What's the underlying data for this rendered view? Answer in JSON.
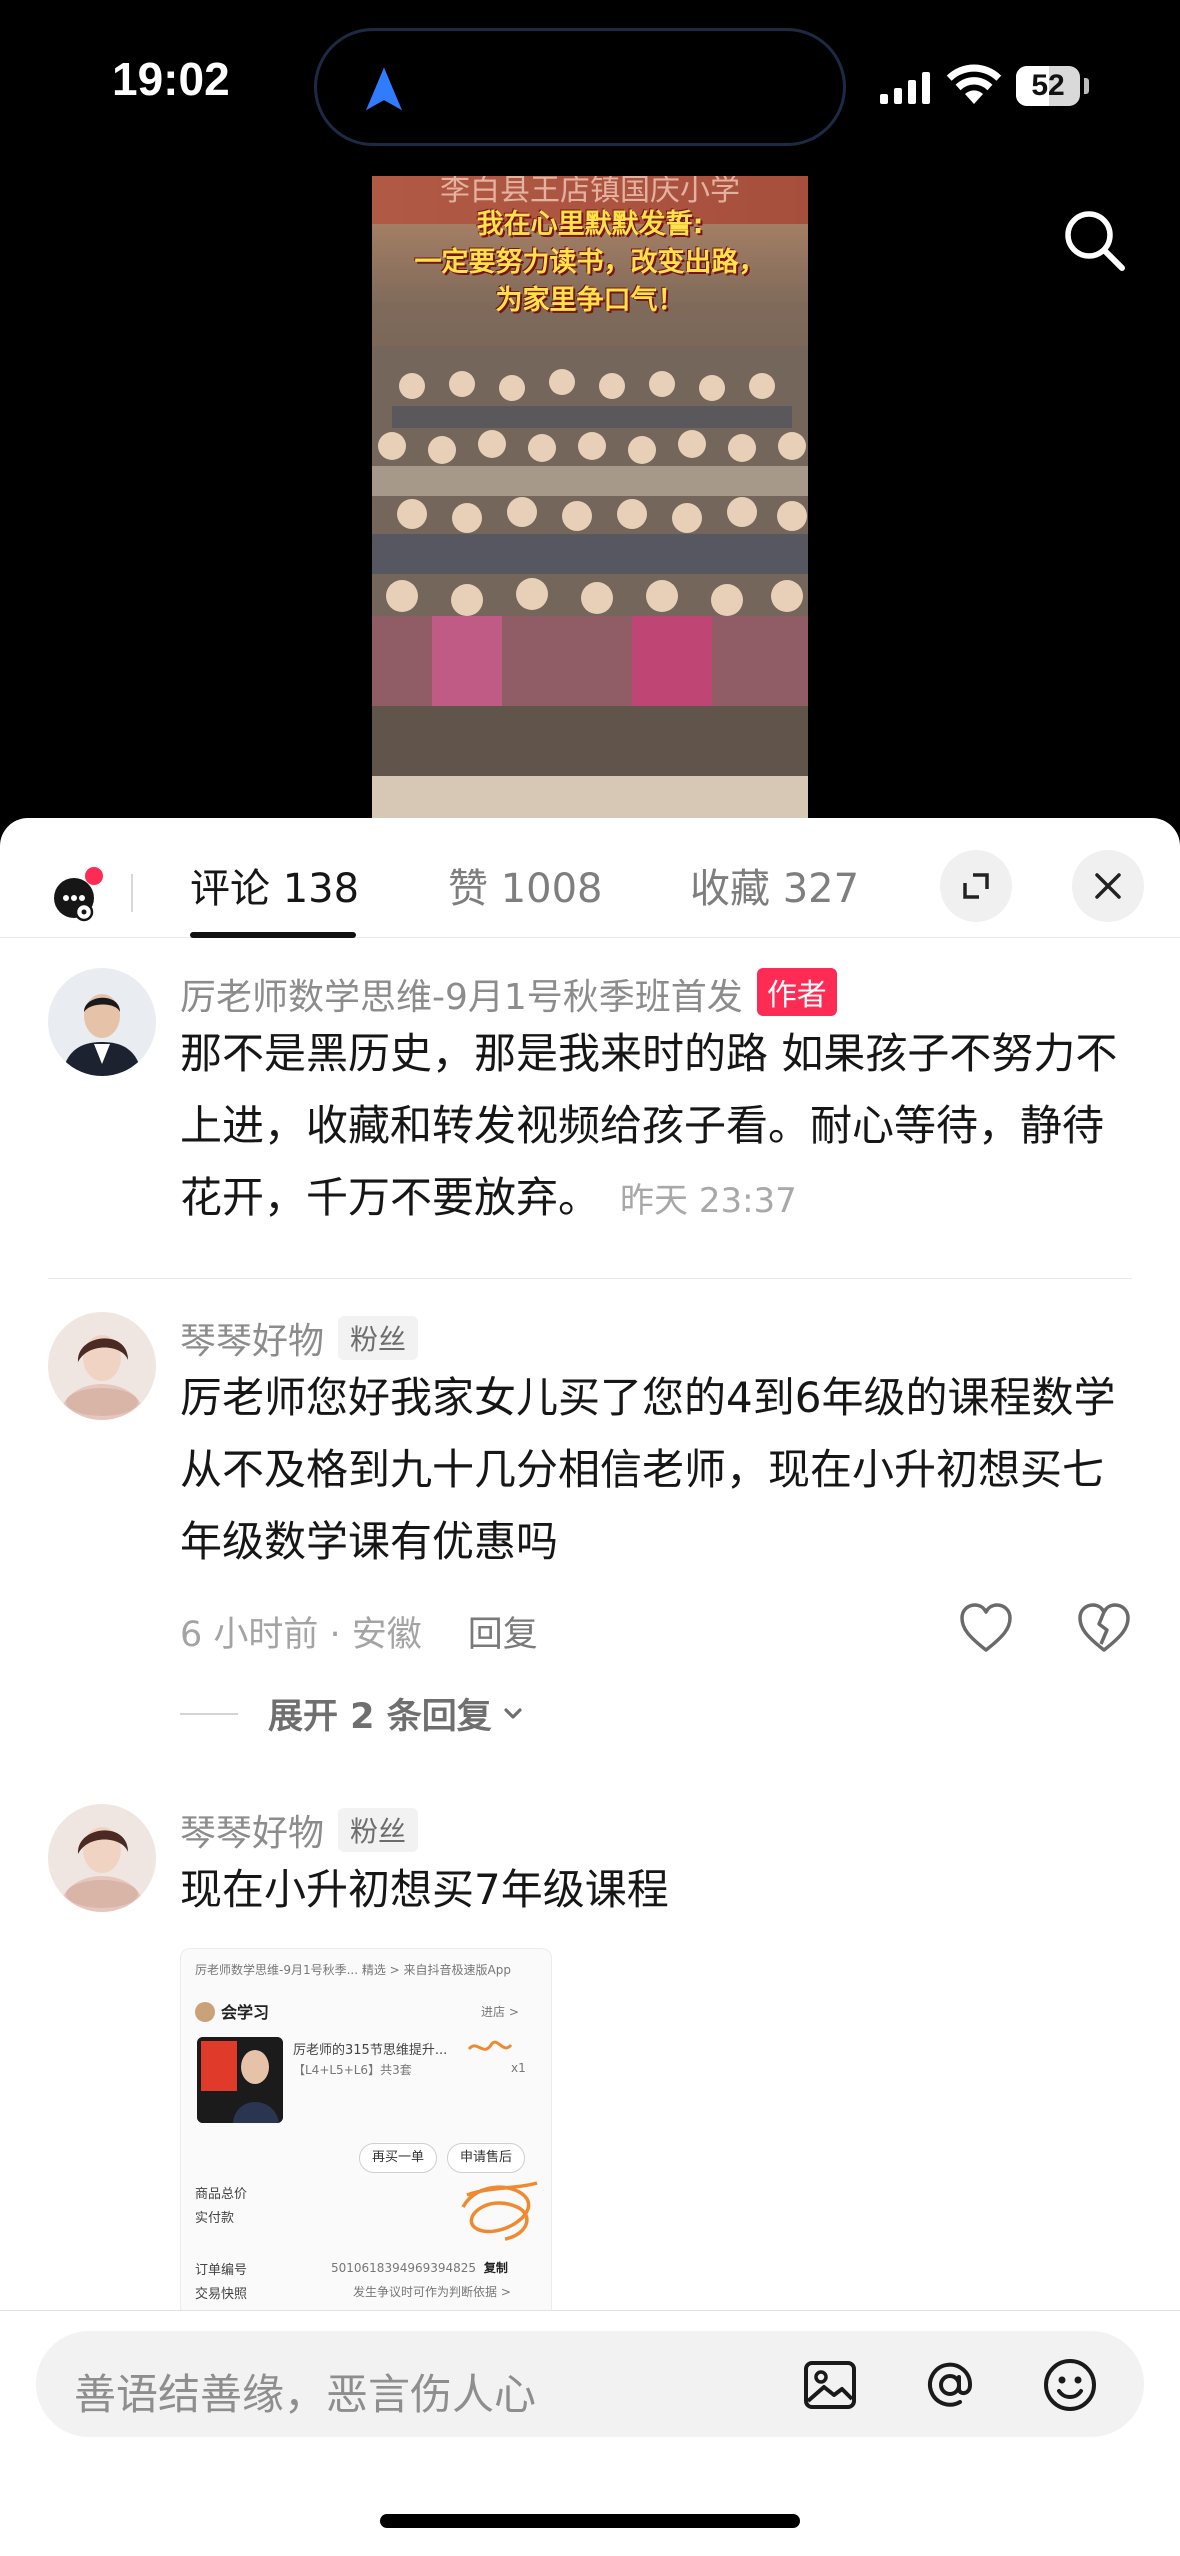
{
  "status": {
    "time": "19:02",
    "battery": "52",
    "battery_level": 0.52
  },
  "video": {
    "top_text": "李白县王店镇国庆小学",
    "caption": [
      "我在心里默默发誓:",
      "一定要努力读书，改变出路，",
      "为家里争口气！"
    ]
  },
  "tabs": [
    {
      "label": "评论 138"
    },
    {
      "label": "赞 1008"
    },
    {
      "label": "收藏 327"
    }
  ],
  "comments": [
    {
      "name": "厉老师数学思维-9月1号秋季班首发",
      "badge": "作者",
      "text": "那不是黑历史，那是我来时的路 如果孩子不努力不上进，收藏和转发视频给孩子看。耐心等待，静待花开，千万不要放弃。",
      "time": "昨天 23:37"
    },
    {
      "name": "琴琴好物",
      "badge": "粉丝",
      "text": "厉老师您好我家女儿买了您的4到6年级的课程数学从不及格到九十几分相信老师，现在小升初想买七年级数学课有优惠吗",
      "meta": "6 小时前 · 安徽",
      "reply": "回复",
      "expand": "展开 2 条回复"
    },
    {
      "name": "琴琴好物",
      "badge": "粉丝",
      "text": "现在小升初想买7年级课程"
    }
  ],
  "order_screenshot": {
    "header": "厉老师数学思维-9月1号秋季...  精选 >  来自抖音极速版App",
    "shop": "会学习",
    "shop_link": "进店 >",
    "product": "厉老师的315节思维提升...",
    "spec": "【L4+L5+L6】共3套",
    "qty": "x1",
    "btn_rebuy": "再买一单",
    "btn_after": "申请售后",
    "total_label": "商品总价",
    "paid_label": "实付款",
    "order_label": "订单编号",
    "order_no": "5010618394969394825",
    "copy": "复制",
    "snapshot_label": "交易快照",
    "snapshot_note": "发生争议时可作为判断依据 >"
  },
  "input": {
    "placeholder": "善语结善缘，恶言伤人心"
  }
}
